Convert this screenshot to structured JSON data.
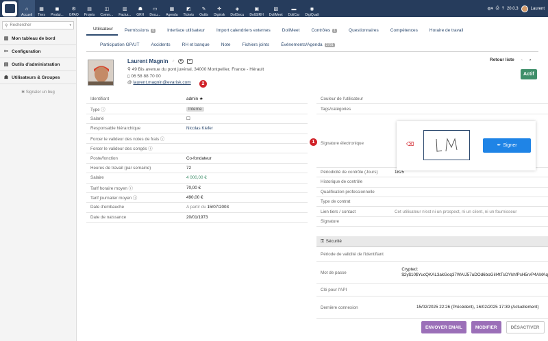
{
  "topbar": {
    "menus": [
      {
        "label": "Accueil",
        "icon": "home-icon",
        "glyph": "⌂"
      },
      {
        "label": "Tiers",
        "icon": "building-icon",
        "glyph": "▦"
      },
      {
        "label": "Produi...",
        "icon": "box-icon",
        "glyph": "◼"
      },
      {
        "label": "GPAO",
        "icon": "factory-icon",
        "glyph": "⚙"
      },
      {
        "label": "Projets",
        "icon": "project-icon",
        "glyph": "▤"
      },
      {
        "label": "Comm...",
        "icon": "cart-icon",
        "glyph": "◫"
      },
      {
        "label": "Factur...",
        "icon": "invoice-icon",
        "glyph": "▥"
      },
      {
        "label": "GRH",
        "icon": "users-icon",
        "glyph": "☗"
      },
      {
        "label": "Docu...",
        "icon": "document-icon",
        "glyph": "▭"
      },
      {
        "label": "Agenda",
        "icon": "calendar-icon",
        "glyph": "▦"
      },
      {
        "label": "Tickets",
        "icon": "ticket-icon",
        "glyph": "◩"
      },
      {
        "label": "Outils",
        "icon": "wrench-icon",
        "glyph": "✎"
      },
      {
        "label": "Digirisk",
        "icon": "digirisk-icon",
        "glyph": "✣"
      },
      {
        "label": "DoliSecu",
        "icon": "padlock-icon",
        "glyph": "◈"
      },
      {
        "label": "DoliSIRH",
        "icon": "sirh-icon",
        "glyph": "▣"
      },
      {
        "label": "DoliMeet",
        "icon": "meet-icon",
        "glyph": "▧"
      },
      {
        "label": "DoliCar",
        "icon": "car-icon",
        "glyph": "▬"
      },
      {
        "label": "DigiQuali",
        "icon": "quality-icon",
        "glyph": "◉"
      }
    ],
    "version": "20.0.3",
    "username": "Laurent"
  },
  "sidebar": {
    "search_placeholder": "Rechercher",
    "items": [
      {
        "label": "Mon tableau de bord",
        "icon": "dashboard-icon",
        "glyph": "▥"
      },
      {
        "label": "Configuration",
        "icon": "tools-icon",
        "glyph": "✂"
      },
      {
        "label": "Outils d'administration",
        "icon": "admin-tools-icon",
        "glyph": "▤"
      },
      {
        "label": "Utilisateurs & Groupes",
        "icon": "user-icon",
        "glyph": "☗"
      }
    ],
    "bug": "Signaler un bug"
  },
  "tabs_row1": [
    {
      "label": "Utilisateur",
      "badge": ""
    },
    {
      "label": "Permissions",
      "badge": "0"
    },
    {
      "label": "Interface utilisateur",
      "badge": ""
    },
    {
      "label": "Import calendriers externes",
      "badge": ""
    },
    {
      "label": "DoliMeet",
      "badge": ""
    },
    {
      "label": "Contrôles",
      "badge": "1"
    },
    {
      "label": "Questionnaires",
      "badge": ""
    },
    {
      "label": "Compétences",
      "badge": ""
    },
    {
      "label": "Horaire de travail",
      "badge": ""
    }
  ],
  "tabs_row2": [
    {
      "label": "Participation GP/UT",
      "badge": ""
    },
    {
      "label": "Accidents",
      "badge": ""
    },
    {
      "label": "RH et banque",
      "badge": ""
    },
    {
      "label": "Note",
      "badge": ""
    },
    {
      "label": "Fichiers joints",
      "badge": ""
    },
    {
      "label": "Événements/Agenda",
      "badge": "2791"
    }
  ],
  "user": {
    "name": "Laurent Magnin",
    "address": "49 Bis avenue du pont juvénal, 34000 Montpellier, France - Hérault",
    "phone": "06 58 88 70 00",
    "email": "laurent.magnin@evarisk.com",
    "status": "Actif"
  },
  "nav": {
    "retour": "Retour liste",
    "prev": "‹",
    "next": "›"
  },
  "callouts": {
    "one": "1",
    "two": "2"
  },
  "left_fields": [
    {
      "label": "Identifiant",
      "value": "admin ★"
    },
    {
      "label": "Type ⓘ",
      "value": "Interne"
    },
    {
      "label": "Salarié",
      "value": "☐"
    },
    {
      "label": "Responsable hiérarchique",
      "value": "Nicolas Kiefer"
    },
    {
      "label": "Forcer le valideur des notes de frais ⓘ",
      "value": ""
    },
    {
      "label": "Forcer le valideur des congés ⓘ",
      "value": ""
    },
    {
      "label": "Poste/fonction",
      "value": "Co-fondateur"
    },
    {
      "label": "Heures de travail (par semaine)",
      "value": "72"
    },
    {
      "label": "Salaire",
      "value": "4 000,00 €"
    },
    {
      "label": "Tarif horaire moyen ⓘ",
      "value": "70,00 €"
    },
    {
      "label": "Tarif journalier moyen ⓘ",
      "value": "490,00 €"
    },
    {
      "label": "Date d'embauche",
      "value_prefix": "A partir du",
      "value": "15/07/2003"
    },
    {
      "label": "Date de naissance",
      "value": "20/01/1973"
    }
  ],
  "right_fields": {
    "top": [
      {
        "label": "Couleur de l'utilisateur",
        "value": ""
      },
      {
        "label": "Tags/catégories",
        "value": ""
      }
    ],
    "signature_label": "Signature électronique",
    "signer_label": "Signer",
    "signature_text": "LM",
    "bottom": [
      {
        "label": "Périodicité de contrôle (Jours)",
        "value": "1825"
      },
      {
        "label": "Historique de contrôle",
        "value": ""
      },
      {
        "label": "Qualification professionnelle",
        "value": ""
      },
      {
        "label": "Type de contrat",
        "value": ""
      },
      {
        "label": "Lien tiers / contact",
        "value": "Cet utilisateur n'est ni un prospect, ni un client, ni un fournisseur"
      },
      {
        "label": "Signature",
        "value": ""
      }
    ]
  },
  "security": {
    "title": "Sécurité",
    "rows": [
      {
        "label": "Période de validité de l'identifiant",
        "value": ""
      },
      {
        "label": "Mot de passe",
        "value": "Crypted: $2y$10$YucQKAL3akGoq37WAIJ57uDOd6boGiII4tTsOYkhfPsH5rvP4AMAq"
      },
      {
        "label": "Clé pour l'API",
        "value": ""
      },
      {
        "label": "Dernière connexion",
        "value": "15/02/2025 22:26 (Précédent), 16/02/2025 17:39 (Actuellement)"
      }
    ]
  },
  "buttons": {
    "send_email": "ENVOYER EMAIL",
    "modify": "MODIFIER",
    "deactivate": "DÉSACTIVER"
  }
}
